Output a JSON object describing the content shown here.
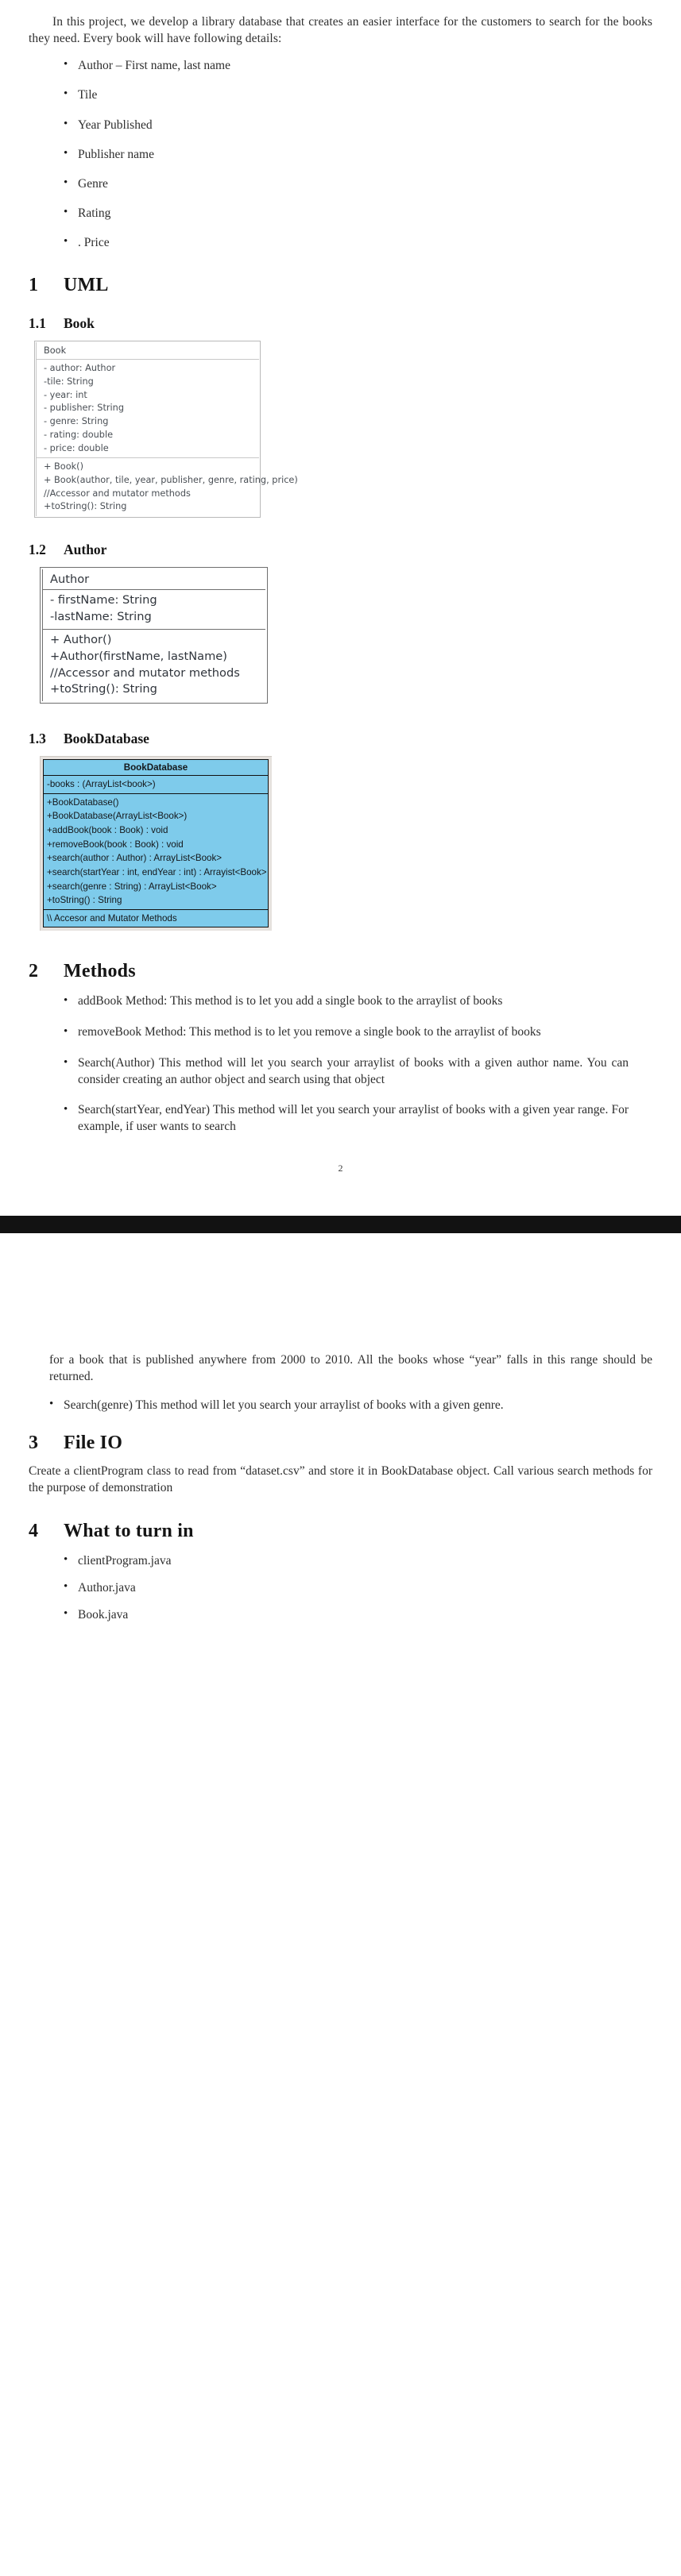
{
  "document": {
    "intro_paragraph": "In this project, we develop a library database that creates an easier interface for the customers to search for the books they need. Every book will have following details:",
    "intro_bullets": [
      "Author – First name, last name",
      "Tile",
      "Year Published",
      "Publisher name",
      "Genre",
      "Rating",
      ". Price"
    ],
    "sections": {
      "uml": {
        "number": "1",
        "title": "UML"
      },
      "book": {
        "number": "1.1",
        "title": "Book"
      },
      "author": {
        "number": "1.2",
        "title": "Author"
      },
      "bookdatabase": {
        "number": "1.3",
        "title": "BookDatabase"
      },
      "methods": {
        "number": "2",
        "title": "Methods"
      },
      "file_io": {
        "number": "3",
        "title": "File IO"
      },
      "turn_in": {
        "number": "4",
        "title": "What to turn in"
      }
    },
    "uml_book": {
      "class_name": "Book",
      "attributes": [
        "- author: Author",
        "-tile: String",
        "- year: int",
        "- publisher: String",
        "- genre: String",
        "- rating: double",
        "- price: double"
      ],
      "methods": [
        "+ Book()",
        "+ Book(author, tile, year, publisher, genre, rating, price)",
        "//Accessor and mutator methods",
        "+toString(): String"
      ]
    },
    "uml_author": {
      "class_name": "Author",
      "attributes": [
        "- firstName: String",
        "-lastName: String"
      ],
      "methods": [
        "+ Author()",
        "+Author(firstName, lastName)",
        "//Accessor and mutator methods",
        "+toString(): String"
      ]
    },
    "uml_bookdatabase": {
      "class_name": "BookDatabase",
      "attributes": [
        "-books : (ArrayList<book>)"
      ],
      "methods": [
        "+BookDatabase()",
        "+BookDatabase(ArrayList<Book>)",
        "+addBook(book : Book) : void",
        "+removeBook(book : Book) : void",
        "+search(author : Author) : ArrayList<Book>",
        "+search(startYear : int, endYear : int) : Arrayist<Book>",
        "+search(genre : String) : ArrayList<Book>",
        "+toString() : String"
      ],
      "footer": [
        "\\\\ Accesor and Mutator Methods"
      ]
    },
    "methods_bullets": [
      "addBook Method: This method is to let you add a single book to the arraylist of books",
      "removeBook Method: This method is to let you remove a single book to the arraylist of books",
      "Search(Author) This method will let you search your arraylist of books with a given author name. You can consider creating an author object and search using that object",
      "Search(startYear, endYear) This method will let you search your arraylist of books with a given year range. For example, if user wants to search"
    ],
    "page_number_1": "2",
    "continuation_paragraph": "for a book that is published anywhere from 2000 to 2010. All the books whose “year” falls in this range should be returned.",
    "continuation_bullets": [
      "Search(genre) This method will let you search your arraylist of books with a given genre."
    ],
    "file_io_paragraph": "Create a clientProgram class to read from “dataset.csv” and store it in BookDatabase object. Call various search methods for the purpose of demonstration",
    "turn_in_bullets": [
      "clientProgram.java",
      "Author.java",
      "Book.java"
    ]
  }
}
